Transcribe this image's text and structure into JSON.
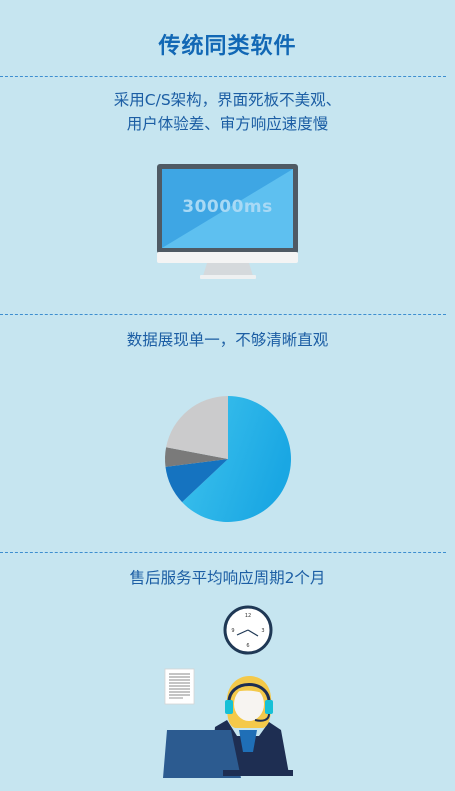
{
  "title": "传统同类软件",
  "sections": [
    {
      "lines": [
        "采用C/S架构，界面死板不美观、",
        "用户体验差、审方响应速度慢"
      ],
      "icon": "monitor-icon",
      "monitor_text": "30000ms"
    },
    {
      "lines": [
        "数据展现单一，不够清晰直观"
      ],
      "icon": "pie-chart-icon",
      "chart_data": {
        "type": "pie",
        "values": [
          63,
          10,
          5,
          22
        ],
        "colors": [
          "#2ab0e8",
          "#1573c0",
          "#7a7a7a",
          "#cbcbcc"
        ]
      }
    },
    {
      "lines": [
        "售后服务平均响应周期2个月"
      ],
      "icon": "customer-service-icon",
      "clock_numbers": [
        "12",
        "3",
        "6",
        "9"
      ]
    }
  ],
  "colors": {
    "background": "#c6e5f0",
    "title": "#1268b5",
    "text": "#1c5ea4",
    "divider": "#3d8ed0"
  }
}
